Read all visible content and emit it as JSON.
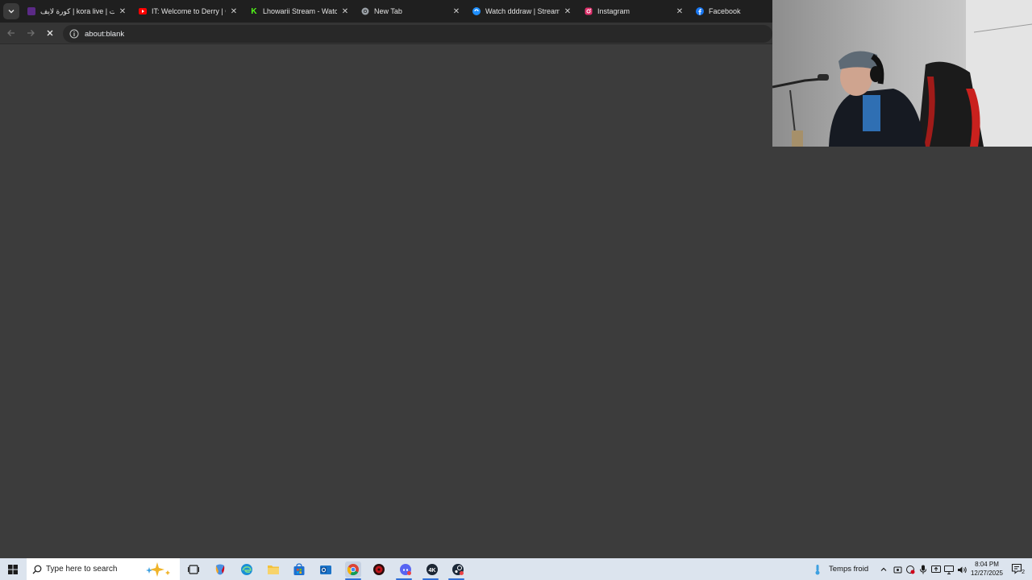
{
  "browser": {
    "tabs": [
      {
        "title": "كورة لايف | kora live | مباريات",
        "favicon": "kora-favicon",
        "color": "#5b2a86"
      },
      {
        "title": "IT: Welcome to Derry | Official",
        "favicon": "youtube-favicon",
        "color": "#ff0000"
      },
      {
        "title": "Lhowarii Stream - Watch Live",
        "favicon": "kick-favicon",
        "color": "#53fc18"
      },
      {
        "title": "New Tab",
        "favicon": "chrome-favicon",
        "color": "#9aa0a6"
      },
      {
        "title": "Watch dddraw | Streamable",
        "favicon": "streamable-favicon",
        "color": "#1f8fff"
      },
      {
        "title": "Instagram",
        "favicon": "instagram-favicon",
        "color": "#e1306c"
      },
      {
        "title": "Facebook",
        "favicon": "facebook-favicon",
        "color": "#1877f2"
      }
    ],
    "address": "about:blank"
  },
  "taskbar": {
    "search_placeholder": "Type here to search",
    "weather": "Temps froid",
    "time": "8:04 PM",
    "date": "12/27/2025",
    "notification_count": "2"
  },
  "colors": {
    "accent": "#2f6fd6",
    "content_bg": "#3c3c3c",
    "taskbar_bg": "#dce4ee"
  }
}
